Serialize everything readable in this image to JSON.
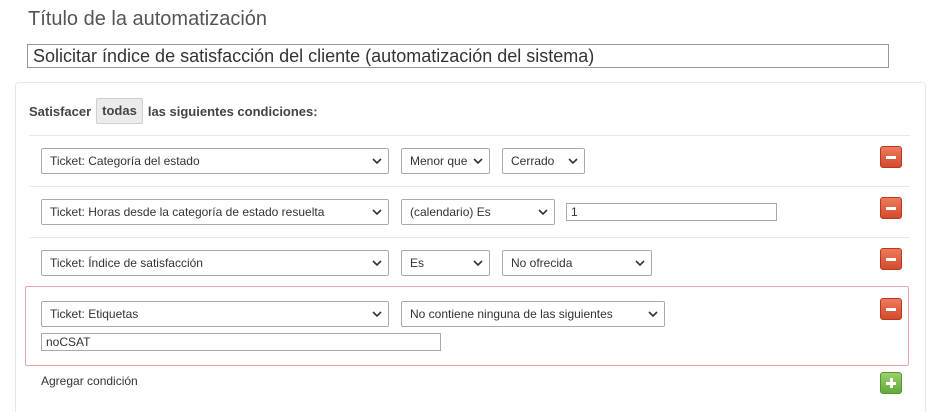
{
  "title_label": "Título de la automatización",
  "title_value": "Solicitar índice de satisfacción del cliente (automatización del sistema)",
  "conditions_header": {
    "prefix": "Satisfacer",
    "match": "todas",
    "suffix": "las siguientes condiciones:"
  },
  "conditions": [
    {
      "field": "Ticket: Categoría del estado",
      "operator": "Menor que",
      "value": "Cerrado"
    },
    {
      "field": "Ticket: Horas desde la categoría de estado resuelta",
      "operator": "(calendario) Es",
      "value": "1"
    },
    {
      "field": "Ticket: Índice de satisfacción",
      "operator": "Es",
      "value": "No ofrecida"
    },
    {
      "field": "Ticket: Etiquetas",
      "operator": "No contiene ninguna de las siguientes",
      "value": "noCSAT"
    }
  ],
  "add_condition_label": "Agregar condición",
  "colors": {
    "remove_button": "#d9563a",
    "add_button": "#77b84c",
    "highlight_border": "#e8a7a7"
  },
  "icons": {
    "remove": "minus-icon",
    "add": "plus-icon",
    "dropdown": "chevron-down-icon"
  }
}
